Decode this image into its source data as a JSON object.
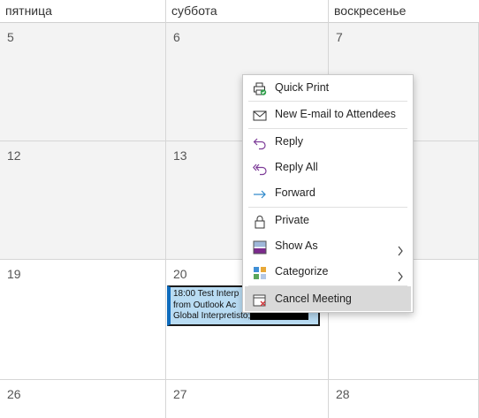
{
  "weekdays": [
    "пятница",
    "суббота",
    "воскресенье"
  ],
  "weeks": [
    [
      "5",
      "6",
      "7"
    ],
    [
      "12",
      "13",
      ""
    ],
    [
      "19",
      "20",
      ""
    ],
    [
      "26",
      "27",
      "28"
    ]
  ],
  "event": {
    "line1": "18:00 Test Interp",
    "line2": "from Outlook Ac",
    "line3": "Global Interpretisto;"
  },
  "menu": {
    "items": [
      {
        "label": "Quick Print",
        "icon": "printer-icon"
      },
      {
        "label": "New E-mail to Attendees",
        "icon": "envelope-icon"
      },
      {
        "label": "Reply",
        "icon": "reply-icon"
      },
      {
        "label": "Reply All",
        "icon": "reply-all-icon"
      },
      {
        "label": "Forward",
        "icon": "forward-icon"
      },
      {
        "label": "Private",
        "icon": "lock-icon"
      },
      {
        "label": "Show As",
        "icon": "show-as-icon"
      },
      {
        "label": "Categorize",
        "icon": "categorize-icon"
      },
      {
        "label": "Cancel Meeting",
        "icon": "cancel-meeting-icon"
      }
    ]
  },
  "colors": {
    "accent": "#0f6cbd",
    "event_bg": "#b9dcf3",
    "reply_purple": "#7d3c98",
    "forward_blue": "#2a86c9",
    "cancel_red": "#d13438"
  }
}
